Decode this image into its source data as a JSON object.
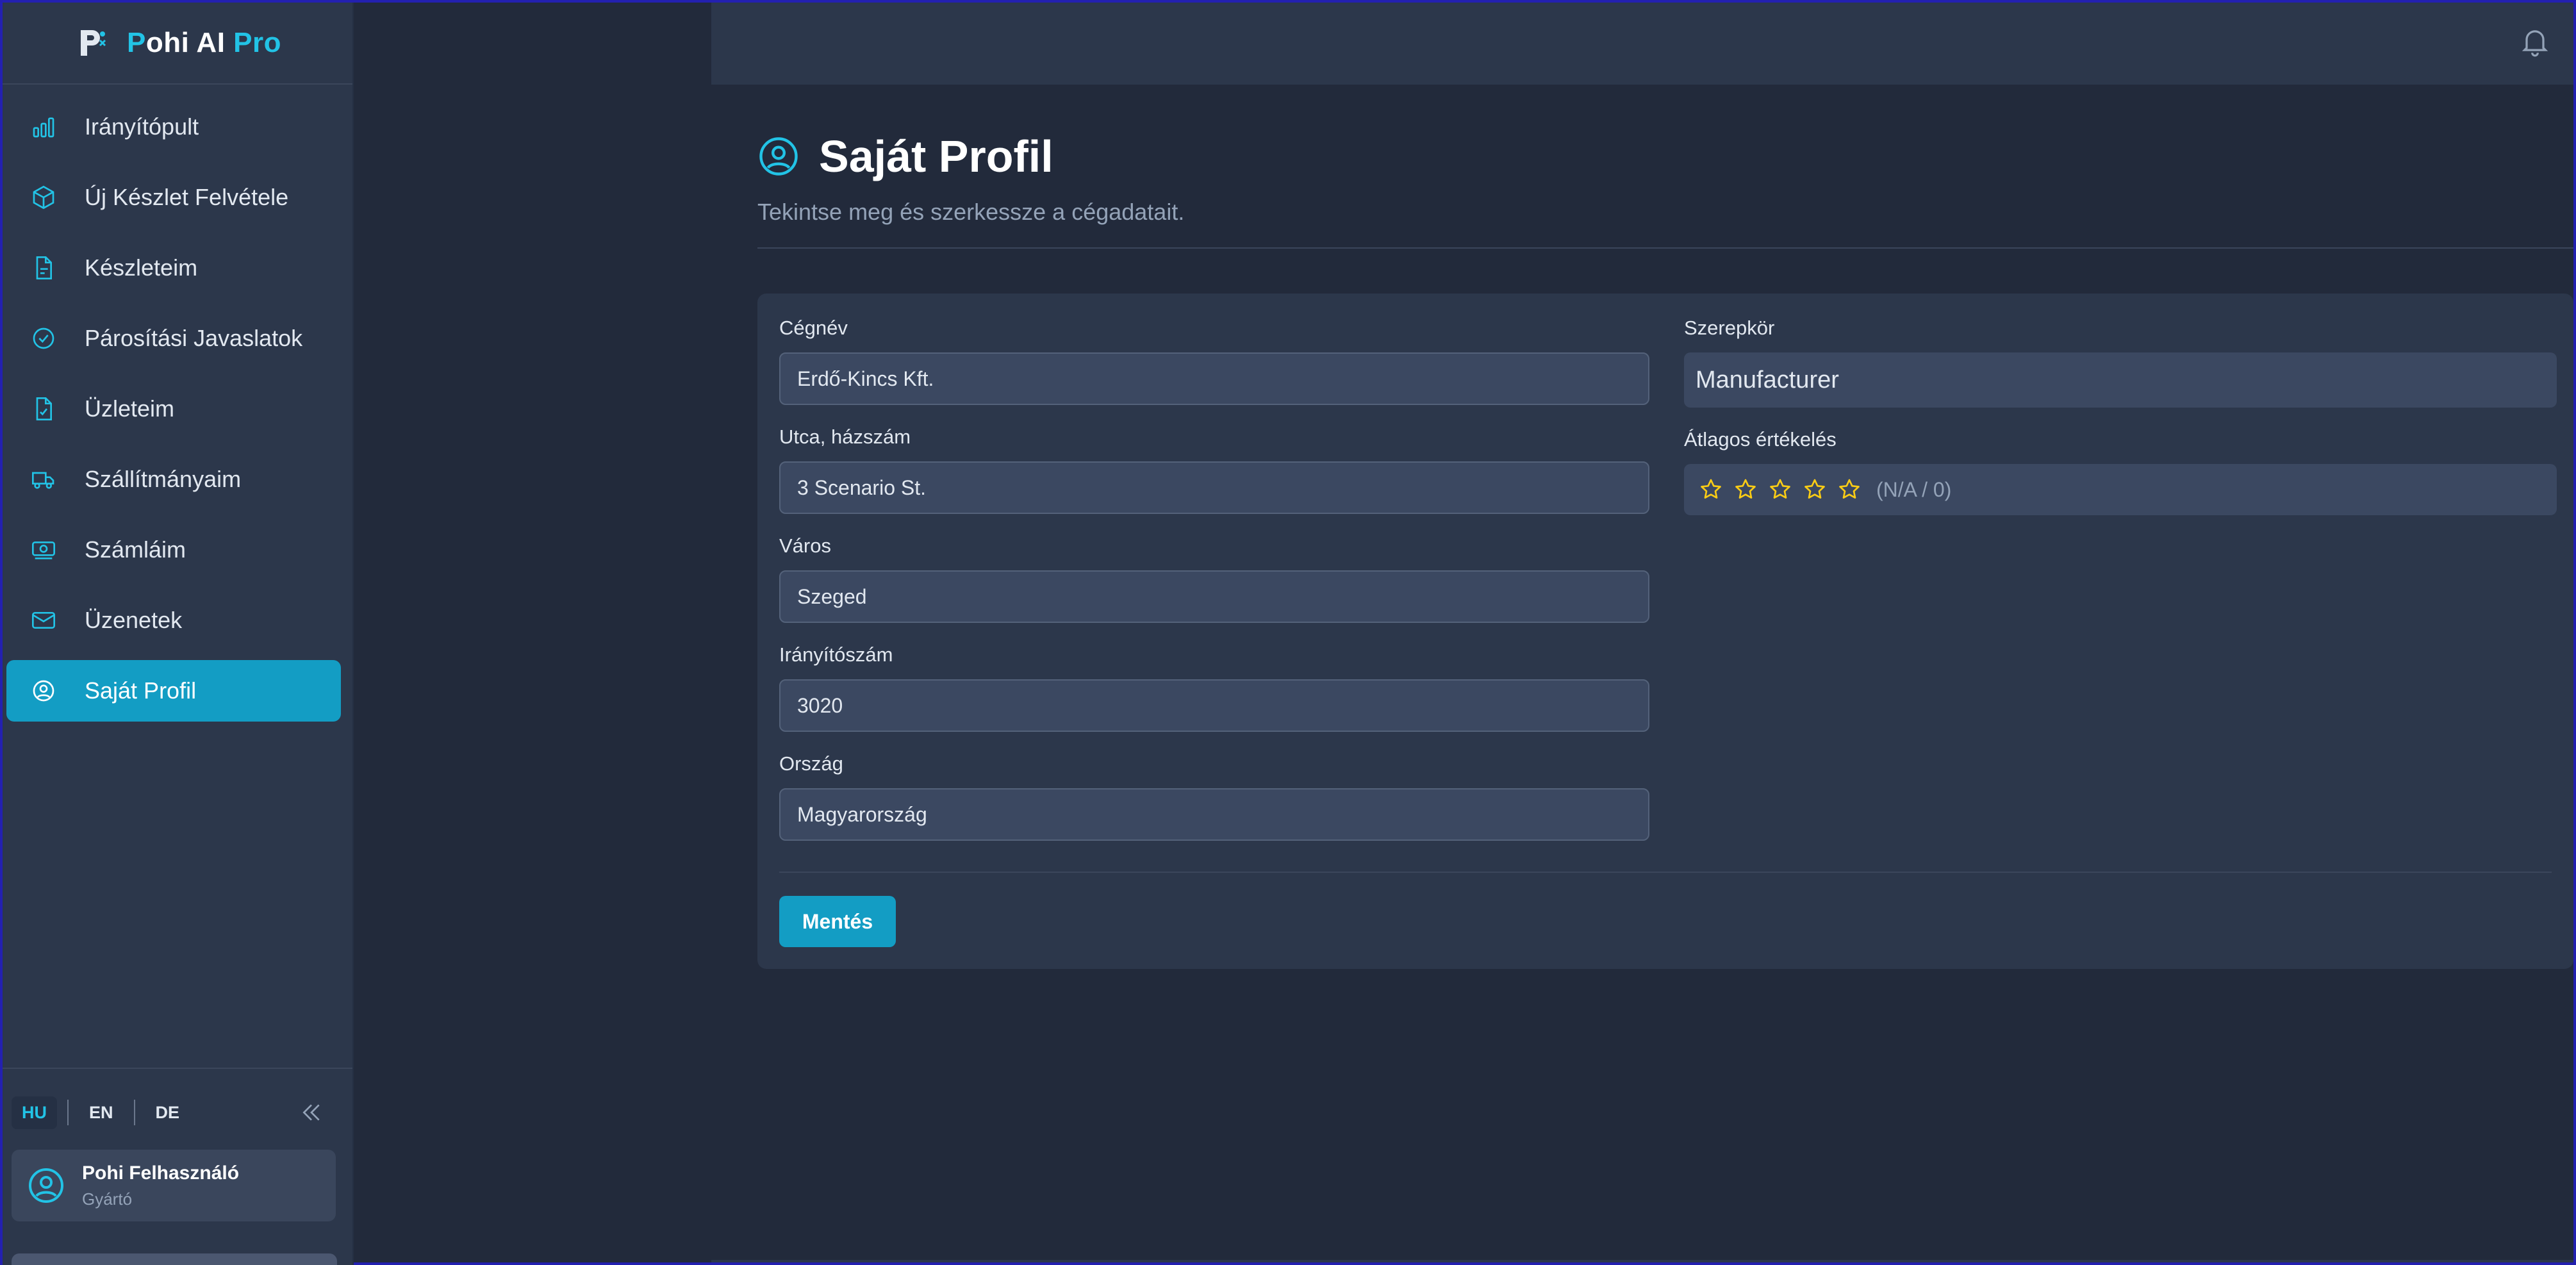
{
  "brand": {
    "name_prefix": "P",
    "name_main": "ohi AI ",
    "name_accent": "Pro"
  },
  "sidebar": {
    "items": [
      {
        "label": "Irányítópult",
        "icon": "bar-chart-icon"
      },
      {
        "label": "Új Készlet Felvétele",
        "icon": "box-icon"
      },
      {
        "label": "Készleteim",
        "icon": "document-icon"
      },
      {
        "label": "Párosítási Javaslatok",
        "icon": "check-circle-icon"
      },
      {
        "label": "Üzleteim",
        "icon": "document-check-icon"
      },
      {
        "label": "Szállítmányaim",
        "icon": "truck-icon"
      },
      {
        "label": "Számláim",
        "icon": "banknote-icon"
      },
      {
        "label": "Üzenetek",
        "icon": "mail-icon"
      },
      {
        "label": "Saját Profil",
        "icon": "user-circle-icon",
        "active": true
      }
    ],
    "languages": [
      "HU",
      "EN",
      "DE"
    ],
    "active_language": "HU"
  },
  "user": {
    "name": "Pohi Felhasználó",
    "role": "Gyártó"
  },
  "page": {
    "title": "Saját Profil",
    "subtitle": "Tekintse meg és szerkessze a cégadatait."
  },
  "form": {
    "company_name": {
      "label": "Cégnév",
      "value": "Erdő-Kincs Kft."
    },
    "street": {
      "label": "Utca, házszám",
      "value": "3 Scenario St."
    },
    "city": {
      "label": "Város",
      "value": "Szeged"
    },
    "zip": {
      "label": "Irányítószám",
      "value": "3020"
    },
    "country": {
      "label": "Ország",
      "value": "Magyarország"
    },
    "role": {
      "label": "Szerepkör",
      "value": "Manufacturer"
    },
    "rating": {
      "label": "Átlagos értékelés",
      "text": "(N/A / 0)",
      "stars_filled": 0,
      "stars_total": 5
    },
    "save_label": "Mentés"
  },
  "colors": {
    "accent": "#22c3e6",
    "active_bg": "#139dc4",
    "star": "#facc15"
  }
}
